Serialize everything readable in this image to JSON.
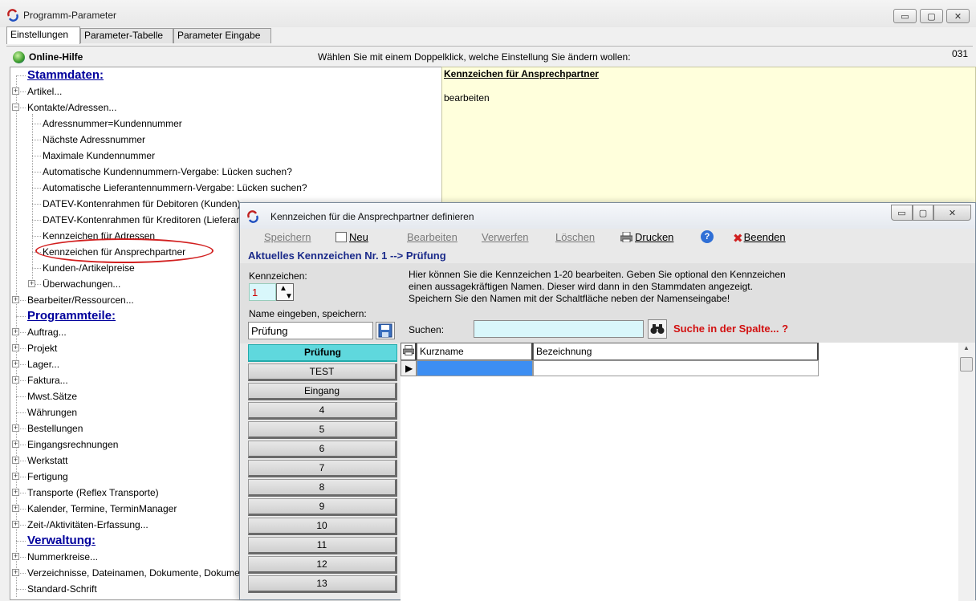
{
  "window": {
    "title": "Programm-Parameter",
    "minimize_glyph": "▭",
    "maximize_glyph": "▢",
    "close_glyph": "✕"
  },
  "tabs": [
    {
      "label": "Einstellungen",
      "active": true
    },
    {
      "label": "Parameter-Tabelle",
      "active": false
    },
    {
      "label": "Parameter Eingabe",
      "active": false
    }
  ],
  "helpbar": {
    "label": "Online-Hilfe",
    "hint": "Wählen Sie mit einem Doppelklick, welche Einstellung Sie ändern wollen:",
    "code": "031"
  },
  "tree": {
    "items": [
      {
        "text": "Stammdaten:",
        "kind": "heading"
      },
      {
        "text": "Artikel...",
        "expander": "+"
      },
      {
        "text": "Kontakte/Adressen...",
        "expander": "−"
      },
      {
        "text": "Adressnummer=Kundennummer"
      },
      {
        "text": "Nächste Adressnummer"
      },
      {
        "text": "Maximale Kundennummer"
      },
      {
        "text": "Automatische Kundennummern-Vergabe: Lücken suchen?"
      },
      {
        "text": "Automatische Lieferantennummern-Vergabe: Lücken suchen?"
      },
      {
        "text": "DATEV-Kontenrahmen für Debitoren (Kunden)"
      },
      {
        "text": "DATEV-Kontenrahmen für Kreditoren (Lieferanten)"
      },
      {
        "text": "Kennzeichen für Adressen"
      },
      {
        "text": "Kennzeichen für Ansprechpartner"
      },
      {
        "text": "Kunden-/Artikelpreise"
      },
      {
        "text": "Überwachungen...",
        "expander": "+"
      },
      {
        "text": "Bearbeiter/Ressourcen...",
        "expander": "+"
      },
      {
        "text": "Programmteile:",
        "kind": "heading"
      },
      {
        "text": "Auftrag...",
        "expander": "+"
      },
      {
        "text": "Projekt",
        "expander": "+"
      },
      {
        "text": "Lager...",
        "expander": "+"
      },
      {
        "text": "Faktura...",
        "expander": "+"
      },
      {
        "text": "Mwst.Sätze"
      },
      {
        "text": "Währungen"
      },
      {
        "text": "Bestellungen",
        "expander": "+"
      },
      {
        "text": "Eingangsrechnungen",
        "expander": "+"
      },
      {
        "text": "Werkstatt",
        "expander": "+"
      },
      {
        "text": "Fertigung",
        "expander": "+"
      },
      {
        "text": "Transporte (Reflex Transporte)",
        "expander": "+"
      },
      {
        "text": "Kalender, Termine, TerminManager",
        "expander": "+"
      },
      {
        "text": "Zeit-/Aktivitäten-Erfassung...",
        "expander": "+"
      },
      {
        "text": "Verwaltung:",
        "kind": "heading"
      },
      {
        "text": "Nummerkreise...",
        "expander": "+"
      },
      {
        "text": "Verzeichnisse, Dateinamen, Dokumente, Dokumentenablage...",
        "expander": "+"
      },
      {
        "text": "Standard-Schrift"
      }
    ]
  },
  "info_panel": {
    "title": "Kennzeichen für Ansprechpartner",
    "body": "bearbeiten"
  },
  "dialog": {
    "title": "Kennzeichen für die Ansprechpartner definieren",
    "toolbar": {
      "save": "Speichern",
      "new": "Neu",
      "edit": "Bearbeiten",
      "discard": "Verwerfen",
      "delete": "Löschen",
      "print": "Drucken",
      "help": "?",
      "exit": "Beenden"
    },
    "current": "Aktuelles Kennzeichen Nr. 1   -->  Prüfung",
    "kennzeichen_label": "Kennzeichen:",
    "kennzeichen_value": "1",
    "name_label": "Name eingeben, speichern:",
    "name_value": "Prüfung",
    "description_lines": [
      "Hier können Sie die Kennzeichen 1-20 bearbeiten. Geben Sie optional den Kennzeichen",
      "einen aussagekräftigen Namen. Dieser wird dann in den Stammdaten angezeigt.",
      "Speichern Sie den Namen mit der Schaltfläche neben der Namenseingabe!"
    ],
    "search_label": "Suchen:",
    "search_value": "",
    "search_hint": "Suche in der Spalte... ?",
    "list_buttons": [
      "Prüfung",
      "TEST",
      "Eingang",
      "4",
      "5",
      "6",
      "7",
      "8",
      "9",
      "10",
      "11",
      "12",
      "13"
    ],
    "active_index": 0,
    "grid": {
      "columns": [
        "Kurzname",
        "Bezeichnung"
      ]
    }
  }
}
